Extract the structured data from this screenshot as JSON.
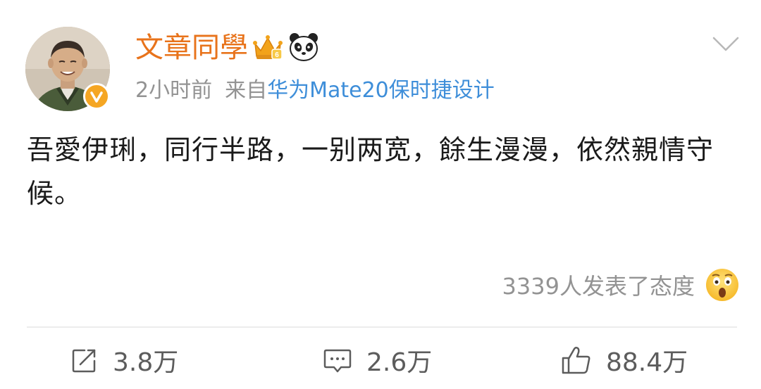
{
  "post": {
    "username": "文章同學",
    "time": "2小时前",
    "from_label": "来自",
    "source": "华为Mate20保时捷设计",
    "content": "吾愛伊琍，同行半路，一别两宽，餘生漫漫，依然親情守候。",
    "attitude_text": "3339人发表了态度"
  },
  "actions": {
    "repost_count": "3.8万",
    "comment_count": "2.6万",
    "like_count": "88.4万"
  },
  "icons": {
    "avatar": "avatar-photo",
    "verify": "verified-badge-icon",
    "crown": "crown-icon",
    "panda": "panda-icon",
    "more": "chevron-down-icon",
    "emoji": "wow-emoji-icon",
    "repost": "repost-icon",
    "comment": "comment-icon",
    "like": "thumbs-up-icon"
  },
  "colors": {
    "username": "#e8731b",
    "meta": "#939393",
    "source_link": "#3e8ed9",
    "verify_badge": "#f5a623",
    "text": "#1a1a1a"
  }
}
